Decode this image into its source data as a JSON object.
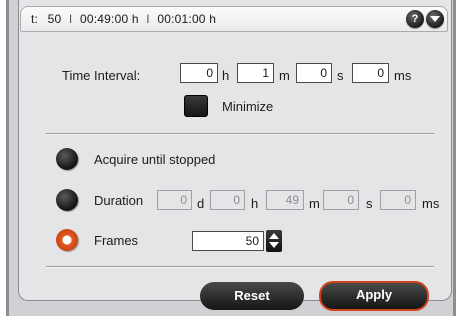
{
  "header": {
    "prefix": "t:",
    "count": "50",
    "separator": "I",
    "duration_total": "00:49:00 h",
    "interval": "00:01:00 h",
    "help_label": "?"
  },
  "time_interval": {
    "label": "Time Interval:",
    "hours": "0",
    "hours_unit": "h",
    "minutes": "1",
    "minutes_unit": "m",
    "seconds": "0",
    "seconds_unit": "s",
    "milliseconds": "0",
    "milliseconds_unit": "ms"
  },
  "minimize": {
    "label": "Minimize",
    "checked": true
  },
  "acquire_until_stopped": {
    "label": "Acquire until stopped",
    "selected": false
  },
  "duration": {
    "label": "Duration",
    "days": "0",
    "days_unit": "d",
    "hours": "0",
    "hours_unit": "h",
    "minutes": "49",
    "minutes_unit": "m",
    "seconds": "0",
    "seconds_unit": "s",
    "milliseconds": "0",
    "milliseconds_unit": "ms",
    "selected": false
  },
  "frames": {
    "label": "Frames",
    "value": "50",
    "selected": true
  },
  "buttons": {
    "reset": "Reset",
    "apply": "Apply"
  },
  "colors": {
    "accent": "#d2441b",
    "panel": "#e4e5e7",
    "frame": "#cfd1d4"
  }
}
